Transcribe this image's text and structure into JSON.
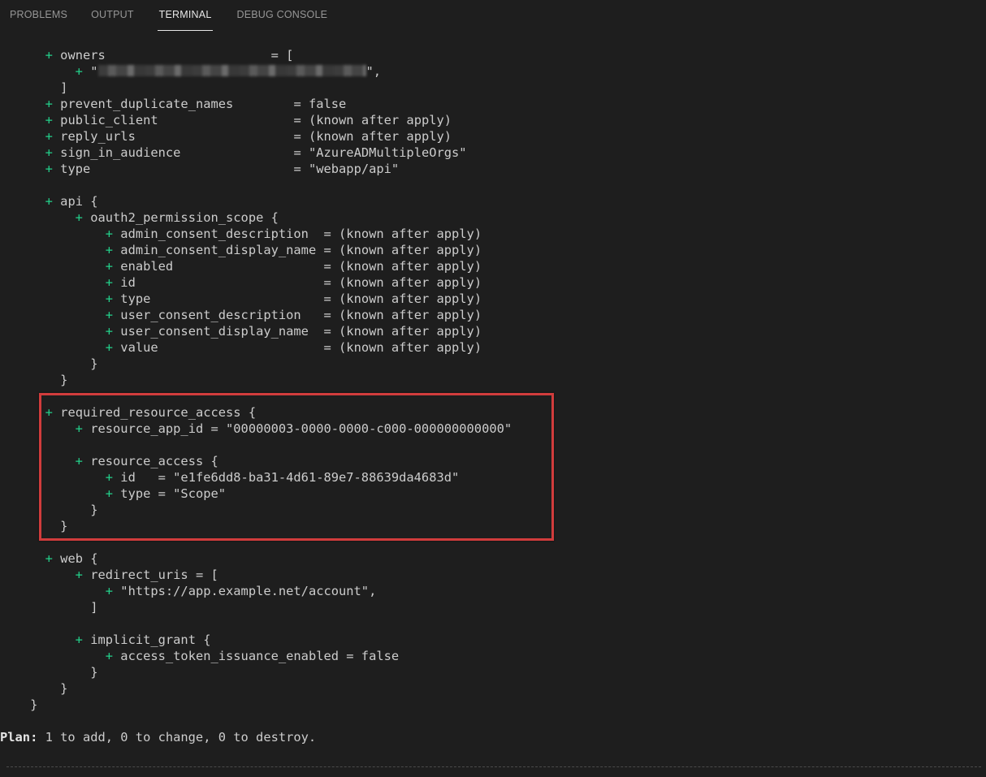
{
  "tabs": [
    {
      "label": "PROBLEMS"
    },
    {
      "label": "OUTPUT"
    },
    {
      "label": "TERMINAL"
    },
    {
      "label": "DEBUG CONSOLE"
    }
  ],
  "active_tab": "TERMINAL",
  "terminal": {
    "plus": "+",
    "owners": {
      "key": "owners",
      "eq": "= [",
      "item_open": "\"",
      "item_close": "\",",
      "close": "]"
    },
    "attrs": [
      {
        "key": "prevent_duplicate_names",
        "value": "= false"
      },
      {
        "key": "public_client",
        "value": "= (known after apply)"
      },
      {
        "key": "reply_urls",
        "value": "= (known after apply)"
      },
      {
        "key": "sign_in_audience",
        "value": "= \"AzureADMultipleOrgs\""
      },
      {
        "key": "type",
        "value": "= \"webapp/api\""
      }
    ],
    "api_open": "api {",
    "scope_open": "oauth2_permission_scope {",
    "scope_attrs": [
      {
        "key": "admin_consent_description",
        "value": "= (known after apply)"
      },
      {
        "key": "admin_consent_display_name",
        "value": "= (known after apply)"
      },
      {
        "key": "enabled",
        "value": "= (known after apply)"
      },
      {
        "key": "id",
        "value": "= (known after apply)"
      },
      {
        "key": "type",
        "value": "= (known after apply)"
      },
      {
        "key": "user_consent_description",
        "value": "= (known after apply)"
      },
      {
        "key": "user_consent_display_name",
        "value": "= (known after apply)"
      },
      {
        "key": "value",
        "value": "= (known after apply)"
      }
    ],
    "close_brace": "}",
    "rra_open": "required_resource_access {",
    "rra_app_id": "resource_app_id = \"00000003-0000-0000-c000-000000000000\"",
    "ra_open": "resource_access {",
    "ra_id": "id   = \"e1fe6dd8-ba31-4d61-89e7-88639da4683d\"",
    "ra_type": "type = \"Scope\"",
    "web_open": "web {",
    "redirect_open": "redirect_uris = [",
    "redirect_item": "\"https://app.example.net/account\",",
    "close_bracket": "]",
    "implicit_open": "implicit_grant {",
    "implicit_attr": "access_token_issuance_enabled = false",
    "plan_label": "Plan:",
    "plan_text": " 1 to add, 0 to change, 0 to destroy."
  },
  "colors": {
    "background": "#1e1e1e",
    "plus": "#23d18b",
    "highlight": "#d13c3c"
  }
}
